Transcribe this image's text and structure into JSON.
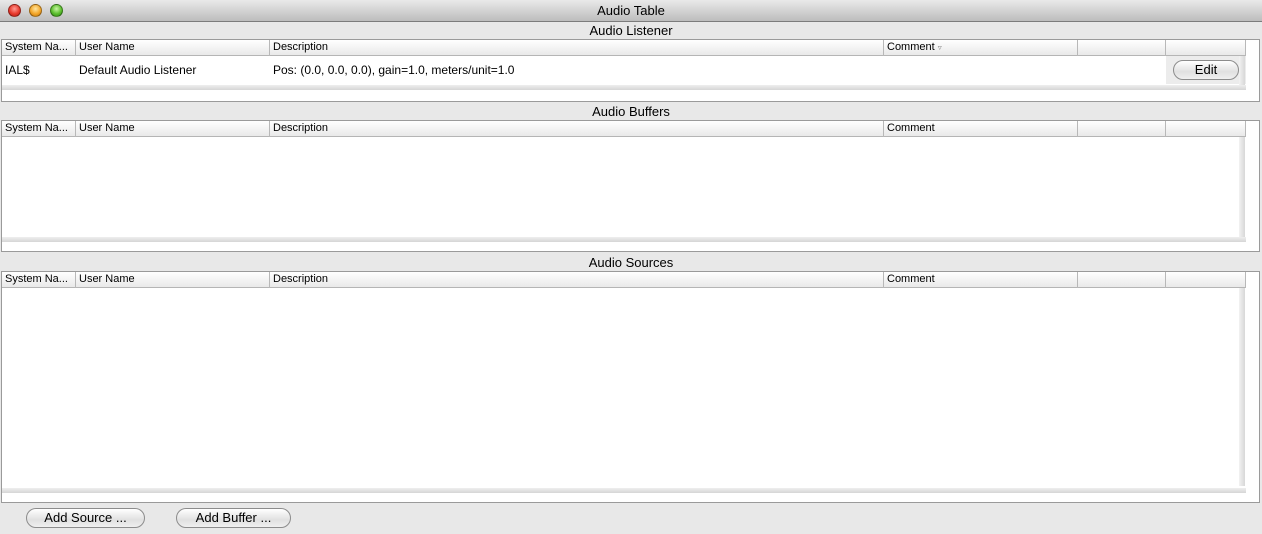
{
  "window": {
    "title": "Audio Table"
  },
  "columns": [
    "System Na...",
    "User Name",
    "Description",
    "Comment",
    "",
    ""
  ],
  "listener": {
    "title": "Audio Listener",
    "rows": [
      {
        "system_name": "IAL$",
        "user_name": "Default Audio Listener",
        "description": "Pos: (0.0, 0.0, 0.0), gain=1.0, meters/unit=1.0",
        "comment": "",
        "extra": "",
        "action_label": "Edit"
      }
    ]
  },
  "buffers": {
    "title": "Audio Buffers"
  },
  "sources": {
    "title": "Audio Sources"
  },
  "buttons": {
    "add_source": "Add Source ...",
    "add_buffer": "Add Buffer ..."
  }
}
